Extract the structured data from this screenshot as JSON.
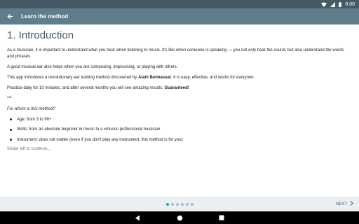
{
  "status": {
    "time": "8:00"
  },
  "app_bar": {
    "title": "Learn the method"
  },
  "content": {
    "heading": "1. Introduction",
    "p1": "As a musician, it is important to understand what you hear when listening to music. It's like when someone is speaking — you not only hear the sound, but also understand the words and phrases.",
    "p2": "A good musical ear also helps when you are composing, improvising, or playing with others.",
    "p3_before": "This app introduces a revolutionary ear training method discovered by ",
    "p3_name": "Alain Benbassat",
    "p3_after": ". It is easy, effective, and works for everyone.",
    "p4_before": "Practice daily for 10 minutes, and after several months you will see amazing results. ",
    "p4_bold": "Guaranteed!",
    "separator": "***",
    "question": "For whom is this method?",
    "bullets": [
      "Age: from 3 to 90+",
      "Skills: from an absolute beginner in music to a virtuoso professional musician",
      "Instrument: does not matter (even if you don't play any instrument, this method is for you)"
    ],
    "hint": "Swipe left to continue..."
  },
  "pager": {
    "total_pages": 6,
    "current_page": 1,
    "next_label": "NEXT"
  },
  "colors": {
    "status_bar": "#455a64",
    "app_bar": "#607d8b",
    "heading": "#455a64",
    "active_dot": "#26a69a"
  },
  "icons": [
    "wifi-icon",
    "signal-icon",
    "battery-icon",
    "back-arrow-icon",
    "chevron-right-icon",
    "nav-back-icon",
    "nav-home-icon",
    "nav-recents-icon"
  ]
}
